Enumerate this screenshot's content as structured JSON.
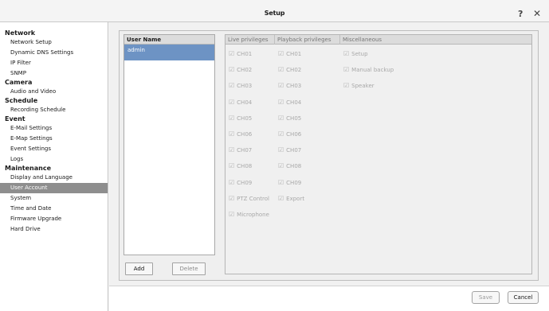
{
  "window": {
    "title": "Setup"
  },
  "sidebar": {
    "groups": [
      {
        "heading": "Network",
        "items": [
          "Network Setup",
          "Dynamic DNS Settings",
          "IP Filter",
          "SNMP"
        ]
      },
      {
        "heading": "Camera",
        "items": [
          "Audio and Video"
        ]
      },
      {
        "heading": "Schedule",
        "items": [
          "Recording Schedule"
        ]
      },
      {
        "heading": "Event",
        "items": [
          "E-Mail Settings",
          "E-Map Settings",
          "Event Settings",
          "Logs"
        ]
      },
      {
        "heading": "Maintenance",
        "items": [
          "Display and Language",
          "User Account",
          "System",
          "Time and Date",
          "Firmware Upgrade",
          "Hard Drive"
        ]
      }
    ],
    "selected": "User Account"
  },
  "users": {
    "header": "User Name",
    "rows": [
      "admin"
    ],
    "add_label": "Add",
    "delete_label": "Delete"
  },
  "privileges": {
    "headers": {
      "live": "Live privileges",
      "playback": "Playback privileges",
      "misc": "Miscellaneous"
    },
    "live": [
      "CH01",
      "CH02",
      "CH03",
      "CH04",
      "CH05",
      "CH06",
      "CH07",
      "CH08",
      "CH09",
      "PTZ Control",
      "Microphone"
    ],
    "playback": [
      "CH01",
      "CH02",
      "CH03",
      "CH04",
      "CH05",
      "CH06",
      "CH07",
      "CH08",
      "CH09",
      "Export"
    ],
    "misc": [
      "Setup",
      "Manual backup",
      "Speaker"
    ],
    "all_checked": true
  },
  "footer": {
    "save_label": "Save",
    "cancel_label": "Cancel"
  },
  "colors": {
    "selected_nav": "#8e8e8e",
    "selected_row": "#6d93c4",
    "disabled_text": "#a8a8a8"
  }
}
